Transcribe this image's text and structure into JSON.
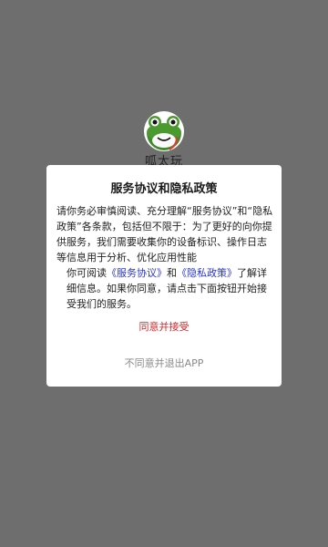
{
  "app": {
    "name": "呱太玩"
  },
  "dialog": {
    "title": "服务协议和隐私政策",
    "paragraph1": "请你务必审慎阅读、充分理解“服务协议”和“隐私政策”各条款，包括但不限于：为了更好的向你提供服务，我们需要收集你的设备标识、操作日志等信息用于分析、优化应用性能",
    "p2_prefix": "你可阅读",
    "link_service": "《服务协议》",
    "p2_and": "和",
    "link_privacy": "《隐私政策》",
    "p2_suffix": "了解详细信息。如果你同意，请点击下面按钮开始接受我们的服务。",
    "agree_label": "同意并接受",
    "disagree_label": "不同意并退出APP"
  },
  "colors": {
    "overlay": "#6e6e6e",
    "agree": "#d1272b",
    "link": "#2a36c8",
    "disagree": "#8a8a8a"
  }
}
